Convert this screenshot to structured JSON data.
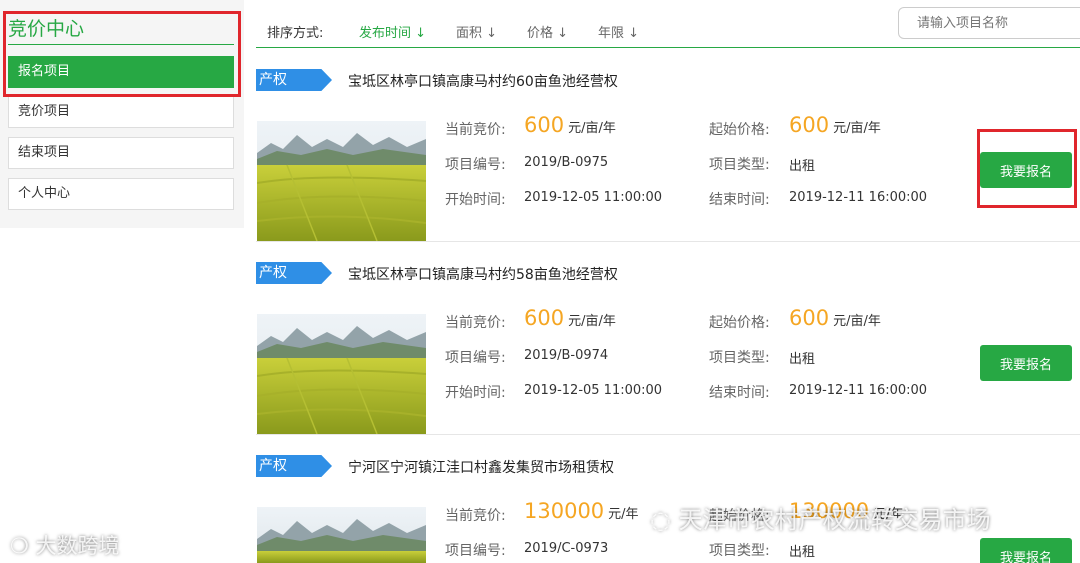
{
  "sidebar": {
    "title": "竞价中心",
    "items": [
      {
        "label": "报名项目",
        "active": true
      },
      {
        "label": "竞价项目",
        "active": false
      },
      {
        "label": "结束项目",
        "active": false
      },
      {
        "label": "个人中心",
        "active": false
      }
    ]
  },
  "sortbar": {
    "label": "排序方式:",
    "options": [
      "发布时间",
      "面积",
      "价格",
      "年限"
    ],
    "active": "发布时间",
    "search_placeholder": "请输入项目名称"
  },
  "labels": {
    "current_bid": "当前竞价:",
    "start_price": "起始价格:",
    "project_no": "项目编号:",
    "project_type": "项目类型:",
    "start_time": "开始时间:",
    "end_time": "结束时间:",
    "unit": "元/亩/年",
    "unit_short": "元/年",
    "apply": "我要报名"
  },
  "listings": [
    {
      "tag": "产权",
      "title": "宝坻区林亭口镇高康马村约60亩鱼池经营权",
      "current_bid": "600",
      "start_price": "600",
      "project_no": "2019/B-0975",
      "project_type": "出租",
      "start_time": "2019-12-05 11:00:00",
      "end_time": "2019-12-11 16:00:00"
    },
    {
      "tag": "产权",
      "title": "宝坻区林亭口镇高康马村约58亩鱼池经营权",
      "current_bid": "600",
      "start_price": "600",
      "project_no": "2019/B-0974",
      "project_type": "出租",
      "start_time": "2019-12-05 11:00:00",
      "end_time": "2019-12-11 16:00:00"
    },
    {
      "tag": "产权",
      "title": "宁河区宁河镇江洼口村鑫发集贸市场租赁权",
      "current_bid": "130000",
      "start_price": "130000",
      "project_no": "2019/C-0973",
      "project_type": "出租"
    }
  ],
  "watermarks": {
    "left": "大数跨境",
    "right": "天津市农村产权流转交易市场"
  }
}
